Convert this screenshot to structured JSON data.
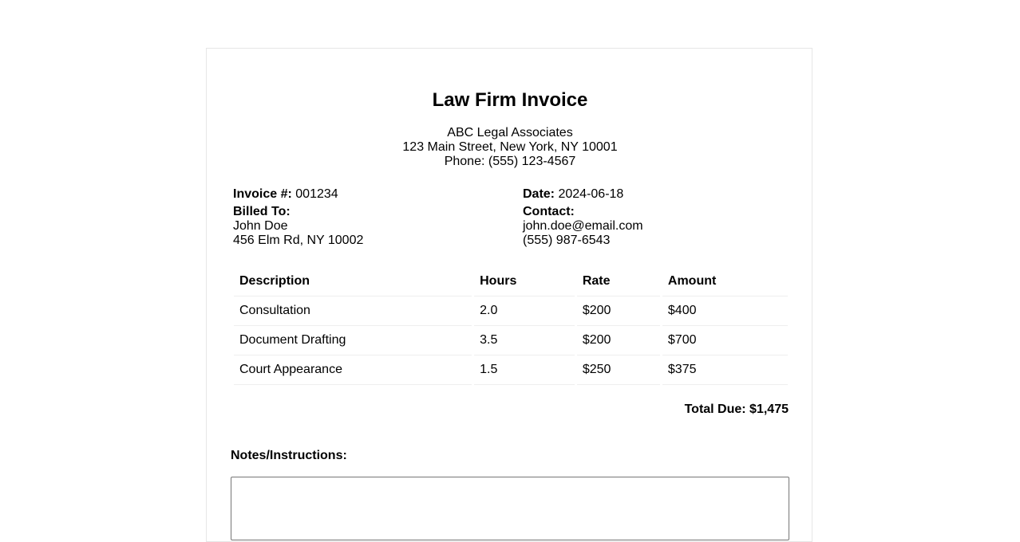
{
  "invoice": {
    "title": "Law Firm Invoice",
    "firm": {
      "name": "ABC Legal Associates",
      "address": "123 Main Street, New York, NY 10001",
      "phone": "Phone: (555) 123-4567"
    },
    "meta": {
      "invoice_label": "Invoice #:",
      "invoice_number": "001234",
      "date_label": "Date:",
      "date_value": "2024-06-18",
      "billed_to_label": "Billed To:",
      "client_name": "John Doe",
      "client_address": "456 Elm Rd, NY 10002",
      "contact_label": "Contact:",
      "contact_email": "john.doe@email.com",
      "contact_phone": "(555) 987-6543"
    },
    "table": {
      "headers": [
        "Description",
        "Hours",
        "Rate",
        "Amount"
      ],
      "rows": [
        [
          "Consultation",
          "2.0",
          "$200",
          "$400"
        ],
        [
          "Document Drafting",
          "3.5",
          "$200",
          "$700"
        ],
        [
          "Court Appearance",
          "1.5",
          "$250",
          "$375"
        ]
      ]
    },
    "total": "Total Due: $1,475",
    "notes": {
      "label": "Notes/Instructions:",
      "value": ""
    }
  }
}
